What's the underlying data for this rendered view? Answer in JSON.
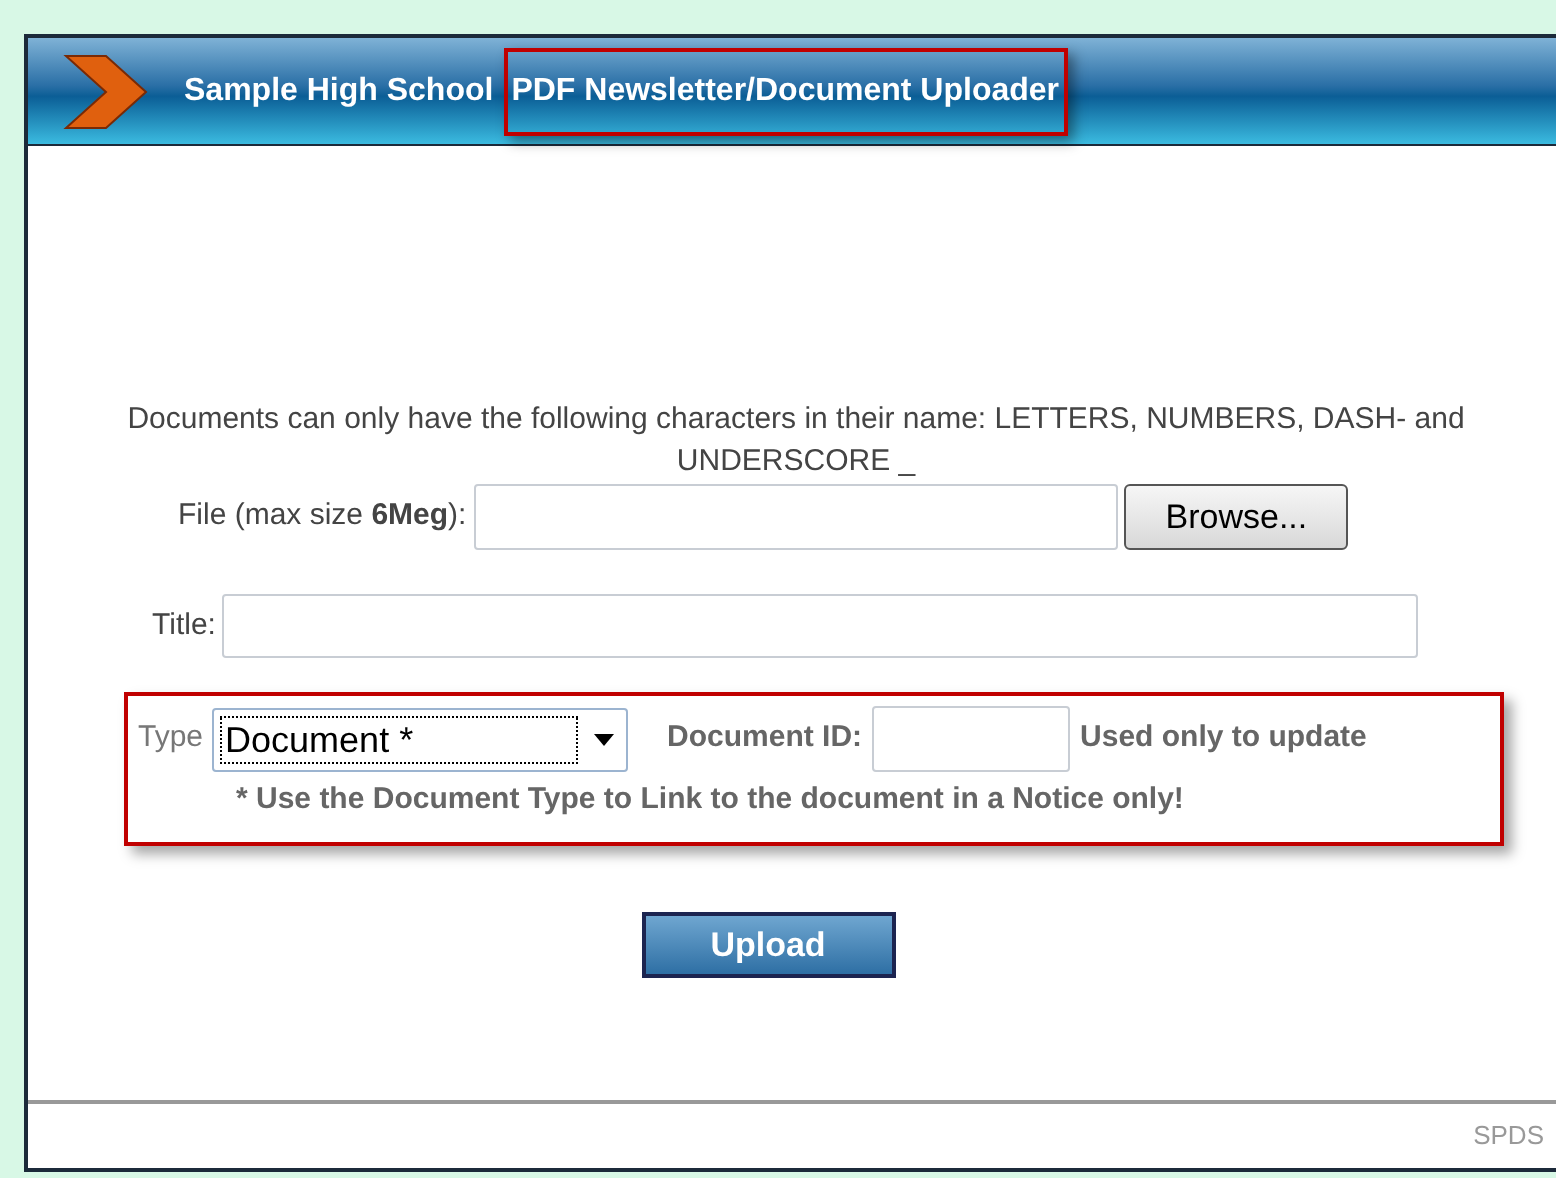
{
  "header": {
    "school": "Sample High School",
    "title": "PDF Newsletter/Document Uploader",
    "title_highlighted": true
  },
  "notice": "Documents can only have the following characters in their name: LETTERS, NUMBERS, DASH- and UNDERSCORE _",
  "file": {
    "label": "File (max size **6Meg**):",
    "browse": "Browse..."
  },
  "title_field": {
    "label": "Title:"
  },
  "type_section": {
    "highlighted": true,
    "type_label": "Type",
    "type_value": "Document *",
    "id_label": "Document ID:",
    "id_hint": "Used only to update",
    "note": "* Use the Document Type to Link to the document in a Notice only!"
  },
  "upload_button": "Upload",
  "footer": "SPDS"
}
